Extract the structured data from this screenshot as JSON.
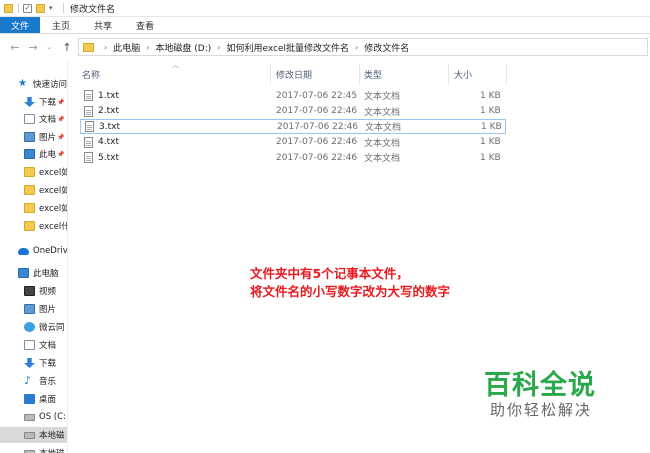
{
  "window": {
    "title": "修改文件名"
  },
  "ribbon": {
    "tabs": [
      "文件",
      "主页",
      "共享",
      "查看"
    ]
  },
  "address": {
    "crumbs": [
      "此电脑",
      "本地磁盘 (D:)",
      "如何利用excel批量修改文件名",
      "修改文件名"
    ]
  },
  "sidebar": {
    "items": [
      {
        "label": "快速访问",
        "icon": "star-icon",
        "pinned": false
      },
      {
        "label": "下载",
        "icon": "download-icon",
        "pinned": true
      },
      {
        "label": "文档",
        "icon": "document-icon",
        "pinned": true
      },
      {
        "label": "图片",
        "icon": "picture-icon",
        "pinned": true
      },
      {
        "label": "此电",
        "icon": "computer-icon",
        "pinned": true
      },
      {
        "label": "excel如",
        "icon": "folder-icon",
        "pinned": false
      },
      {
        "label": "excel如",
        "icon": "folder-icon",
        "pinned": false
      },
      {
        "label": "excel如",
        "icon": "folder-icon",
        "pinned": false
      },
      {
        "label": "excel什",
        "icon": "folder-icon",
        "pinned": false
      },
      {
        "label": "OneDriv",
        "icon": "onedrive-cloud-icon",
        "pinned": false
      },
      {
        "label": "此电脑",
        "icon": "computer-icon",
        "pinned": false
      },
      {
        "label": "视频",
        "icon": "video-icon",
        "pinned": false
      },
      {
        "label": "图片",
        "icon": "picture-icon",
        "pinned": false
      },
      {
        "label": "微云同",
        "icon": "cloud-sync-icon",
        "pinned": false
      },
      {
        "label": "文档",
        "icon": "document-icon",
        "pinned": false
      },
      {
        "label": "下载",
        "icon": "download-icon",
        "pinned": false
      },
      {
        "label": "音乐",
        "icon": "music-icon",
        "pinned": false
      },
      {
        "label": "桌面",
        "icon": "desktop-icon",
        "pinned": false
      },
      {
        "label": "OS (C:",
        "icon": "drive-icon",
        "pinned": false
      },
      {
        "label": "本地磁",
        "icon": "drive-icon",
        "pinned": false
      },
      {
        "label": "本地磁",
        "icon": "drive-icon",
        "pinned": false
      }
    ],
    "pin_glyph": "📌"
  },
  "columns": {
    "name": "名称",
    "modified": "修改日期",
    "type": "类型",
    "size": "大小"
  },
  "files": [
    {
      "name": "1.txt",
      "modified": "2017-07-06 22:45",
      "type": "文本文档",
      "size": "1 KB"
    },
    {
      "name": "2.txt",
      "modified": "2017-07-06 22:46",
      "type": "文本文档",
      "size": "1 KB"
    },
    {
      "name": "3.txt",
      "modified": "2017-07-06 22:46",
      "type": "文本文档",
      "size": "1 KB"
    },
    {
      "name": "4.txt",
      "modified": "2017-07-06 22:46",
      "type": "文本文档",
      "size": "1 KB"
    },
    {
      "name": "5.txt",
      "modified": "2017-07-06 22:46",
      "type": "文本文档",
      "size": "1 KB"
    }
  ],
  "annotation": {
    "line1": "文件夹中有5个记事本文件，",
    "line2": "将文件名的小写数字改为大写的数字",
    "color": "#e8191f"
  },
  "watermark": {
    "title": "百科全说",
    "subtitle": "助你轻松解决"
  },
  "colors": {
    "accent": "#1979ca",
    "folder": "#f3c950",
    "watermark": "#2aa84a"
  }
}
